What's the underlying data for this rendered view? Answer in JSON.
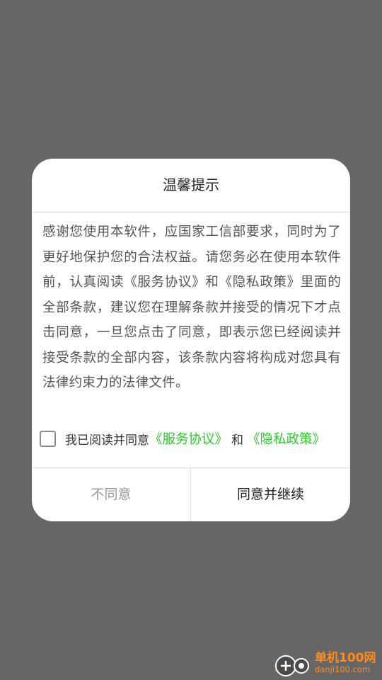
{
  "dialog": {
    "title": "温馨提示",
    "body": "感谢您使用本软件，应国家工信部要求，同时为了更好地保护您的合法权益。请您务必在使用本软件前，认真阅读《服务协议》和《隐私政策》里面的全部条款，建议您在理解条款并接受的情况下才点击同意，一旦您点击了同意，即表示您已经阅读并接受条款的全部内容，该条款内容将构成对您具有法律约束力的法律文件。",
    "agree_prefix": "我已阅读并同意",
    "service_link": "《服务协议》",
    "and_text": "和",
    "privacy_link": "《隐私政策》",
    "checkbox_checked": false,
    "disagree_label": "不同意",
    "agree_label": "同意并继续"
  },
  "watermark": {
    "title": "单机100网",
    "url": "danji100.com"
  },
  "colors": {
    "overlay": "#666666",
    "link": "#2bcc2b",
    "watermark": "#ff8c1a"
  }
}
